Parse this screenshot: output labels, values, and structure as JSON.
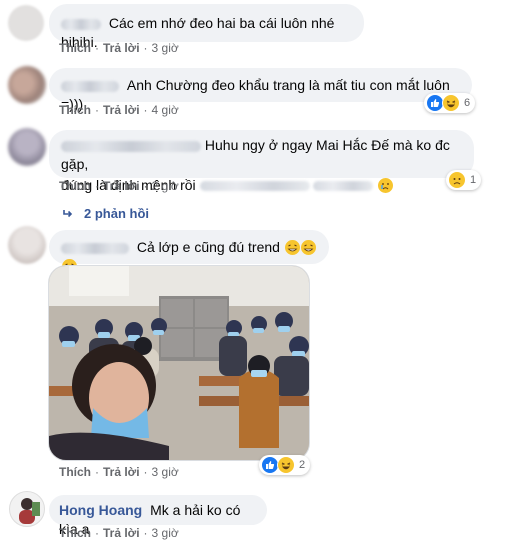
{
  "actions": {
    "like_label": "Thích",
    "reply_label": "Trả lời"
  },
  "comments": [
    {
      "text": "Các em nhớ đeo hai ba cái luôn nhé hihihi.",
      "time": "3 giờ"
    },
    {
      "text": "Anh Chường đeo khẩu trang là mất tiu con mắt luôn =)))",
      "time": "4 giờ",
      "reaction_count": "6"
    },
    {
      "text_line1": "Huhu ngy ở ngay Mai Hắc Đế mà ko đc gặp,",
      "text_line2": "đúng là định mệnh rồi",
      "time": "2 giờ",
      "reaction_count": "1"
    },
    {
      "text": "Cả lớp e cũng đú trend",
      "time": "3 giờ",
      "reaction_count": "2"
    },
    {
      "name": "Hong Hoang",
      "text": "Mk a hải ko có kìa a",
      "time": "3 giờ"
    }
  ],
  "replies_label": "2 phản hồi",
  "colors": {
    "link": "#385898",
    "bubble": "#f0f2f5",
    "meta": "#65676b",
    "like": "#1877f2"
  }
}
